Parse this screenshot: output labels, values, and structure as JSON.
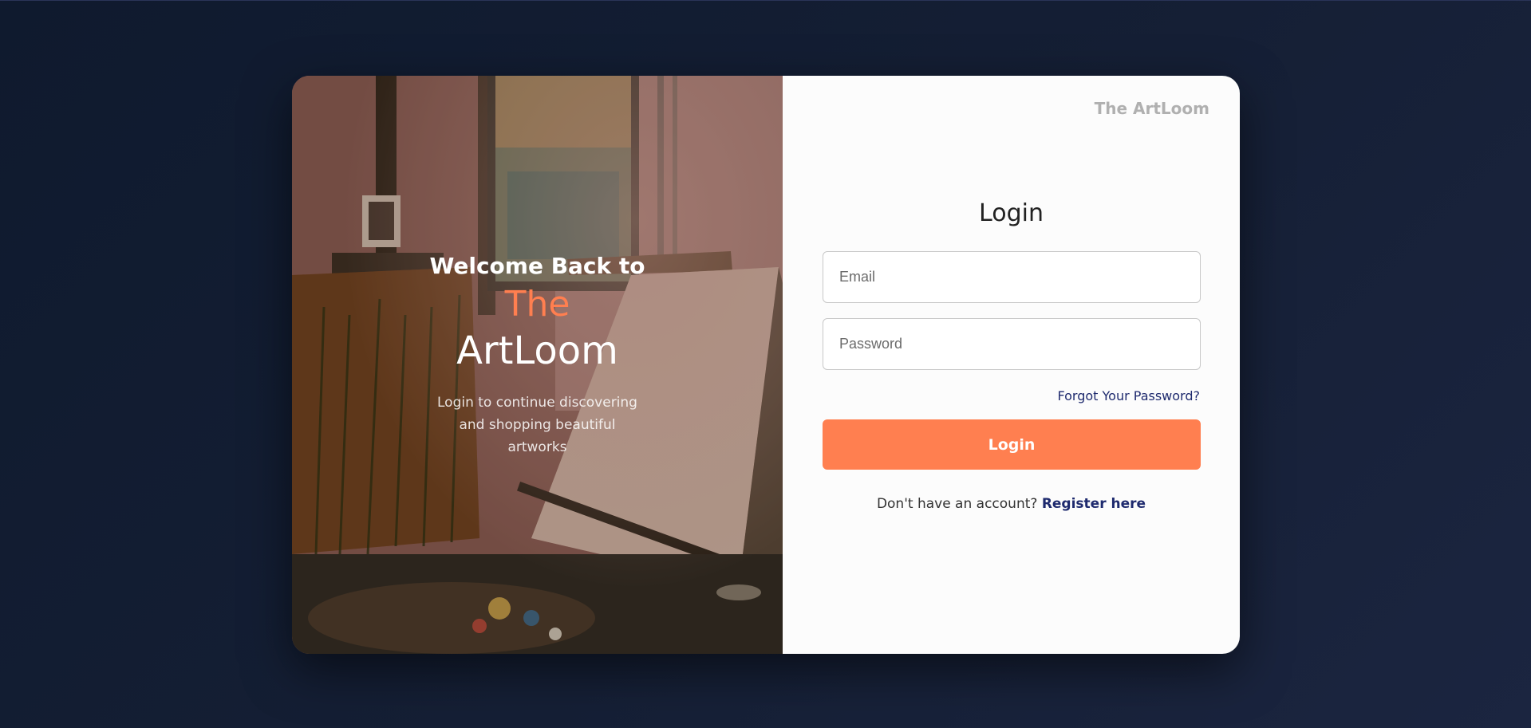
{
  "art_panel": {
    "welcome_line": "Welcome Back to",
    "brand_the": "The",
    "brand_name": "ArtLoom",
    "subtitle": "Login to continue discovering and shopping beautiful artworks"
  },
  "form": {
    "brand": "The ArtLoom",
    "title": "Login",
    "email_placeholder": "Email",
    "password_placeholder": "Password",
    "forgot_label": "Forgot Your Password?",
    "login_label": "Login",
    "register_prompt": "Don't have an account?",
    "register_link": "Register here"
  },
  "colors": {
    "accent": "#ff7f50",
    "link": "#1e2a6e",
    "background": "#131c30"
  }
}
